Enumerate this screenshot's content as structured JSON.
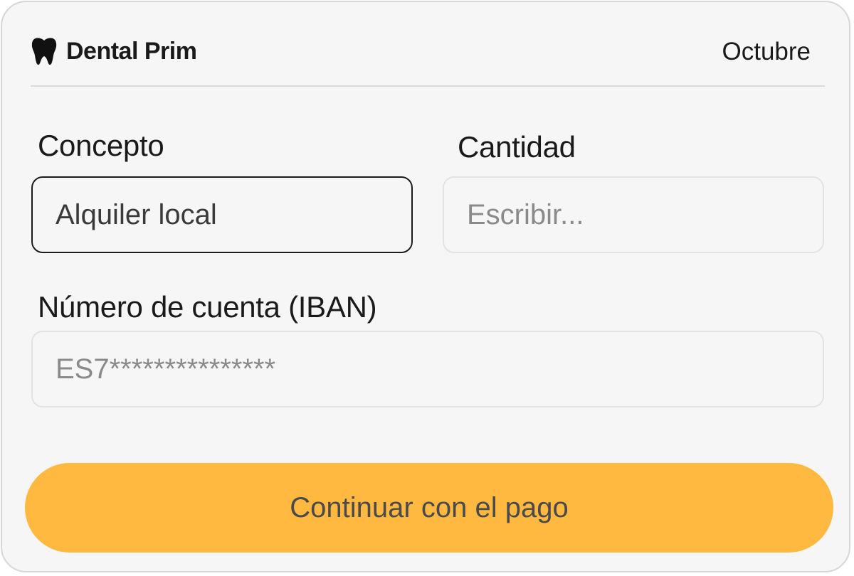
{
  "header": {
    "brand_name": "Dental Prim",
    "brand_icon": "tooth-icon",
    "month": "Octubre"
  },
  "form": {
    "concept": {
      "label": "Concepto",
      "value": "Alquiler local"
    },
    "amount": {
      "label": "Cantidad",
      "placeholder": "Escribir..."
    },
    "iban": {
      "label": "Número de cuenta (IBAN)",
      "value": "ES7***************"
    }
  },
  "actions": {
    "continue_label": "Continuar con el pago"
  },
  "colors": {
    "accent": "#ffb940",
    "card_background": "#f6f6f6",
    "focused_border": "#1c1c1c"
  }
}
